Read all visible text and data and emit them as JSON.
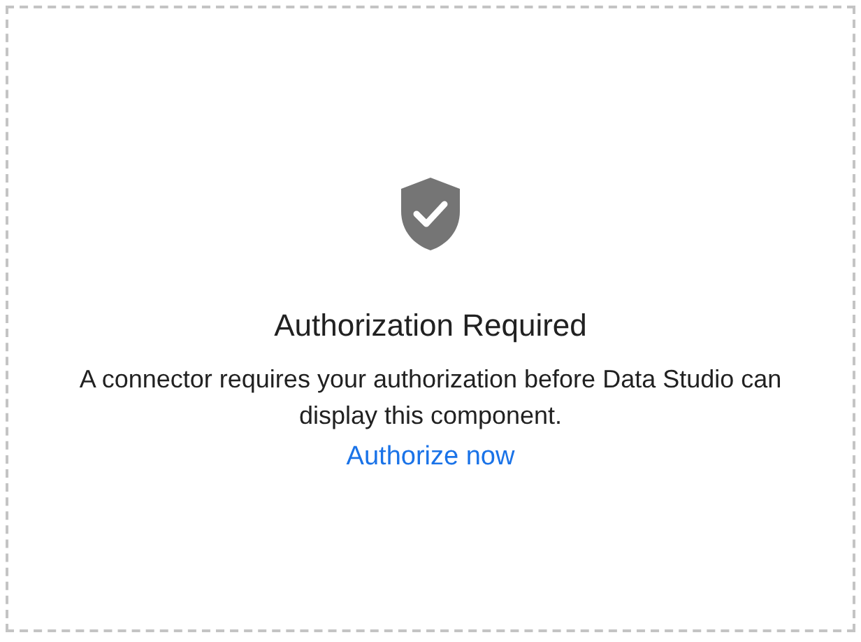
{
  "card": {
    "title": "Authorization Required",
    "message": "A connector requires your authorization before Data Studio can display this component.",
    "link": "Authorize now"
  }
}
